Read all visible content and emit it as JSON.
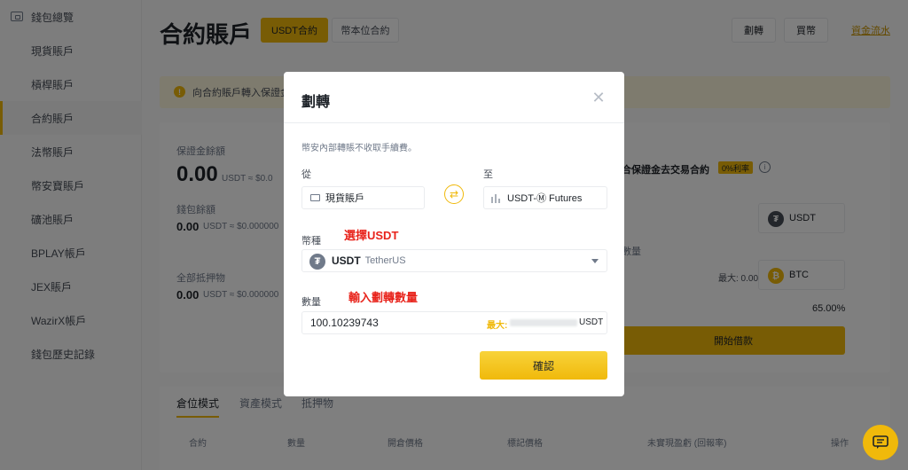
{
  "sidebar": {
    "items": [
      {
        "label": "錢包總覽"
      },
      {
        "label": "現貨賬戶"
      },
      {
        "label": "槓桿賬戶"
      },
      {
        "label": "合約賬戶"
      },
      {
        "label": "法幣賬戶"
      },
      {
        "label": "幣安寶賬戶"
      },
      {
        "label": "礦池賬戶"
      },
      {
        "label": "BPLAY帳戶"
      },
      {
        "label": "JEX賬戶"
      },
      {
        "label": "WazirX帳戶"
      },
      {
        "label": "錢包歷史記錄"
      }
    ]
  },
  "header": {
    "title": "合約賬戶",
    "tabs": [
      "USDT合約",
      "幣本位合約"
    ],
    "buttons": [
      "劃轉",
      "買幣"
    ],
    "fund_flow": "資金流水"
  },
  "notice": {
    "text": "向合約賬戶轉入保證金"
  },
  "card": {
    "margin_balance_label": "保證金餘額",
    "margin_balance_value": "0.00",
    "margin_balance_sub": "USDT ≈ $0.0",
    "wallet_balance_label": "錢包餘額",
    "wallet_balance_value": "0.00",
    "wallet_balance_sub": "USDT ≈ $0.000000",
    "collateral_label": "全部抵押物",
    "collateral_value": "0.00",
    "collateral_sub": "USDT ≈ $0.000000",
    "borrow_title": "合保證金去交易合約",
    "rate_badge": "0%利率",
    "coin1": "USDT",
    "coin2": "BTC",
    "qty_label": "數量",
    "max_text": "最大: 0.00",
    "ratio_value": "65.00%",
    "borrow_btn": "開始借款"
  },
  "bottom": {
    "tabs": [
      "倉位模式",
      "資產模式",
      "抵押物"
    ],
    "headers": [
      "合約",
      "數量",
      "開倉價格",
      "標記價格",
      "未實現盈虧 (回報率)",
      "操作"
    ]
  },
  "modal": {
    "title": "劃轉",
    "fee_note": "幣安內部轉賬不收取手續費。",
    "from_label": "從",
    "from_value": "現貨賬戶",
    "to_label": "至",
    "to_value": "USDT-Ⓜ Futures",
    "coin_label": "幣種",
    "coin_annotation": "選擇USDT",
    "coin_symbol": "USDT",
    "coin_name": "TetherUS",
    "amount_label": "數量",
    "amount_annotation": "輸入劃轉數量",
    "amount_value": "100.10239743",
    "max_label": "最大:",
    "unit": "USDT",
    "confirm": "確認"
  },
  "colors": {
    "accent": "#f0b90b",
    "annotation": "#e8231b"
  }
}
